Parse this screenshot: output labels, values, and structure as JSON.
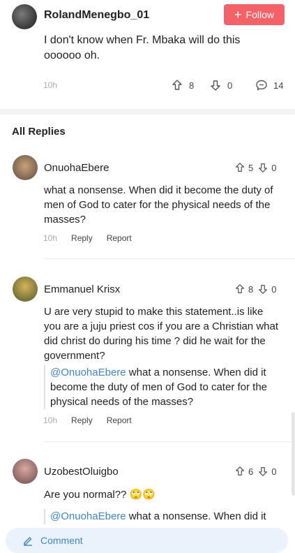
{
  "post": {
    "username": "RolandMenegbo_01",
    "follow_label": "Follow",
    "content": "I don't know when Fr. Mbaka will do this oooooo oh.",
    "time": "10h",
    "upvotes": "8",
    "downvotes": "0",
    "comments": "14"
  },
  "section_title": "All Replies",
  "replies": [
    {
      "name": "OnuohaEbere",
      "upvotes": "5",
      "downvotes": "0",
      "text": "what a nonsense. When did it become the duty of men of God to cater for the physical needs of the masses?",
      "time": "10h",
      "reply_label": "Reply",
      "report_label": "Report"
    },
    {
      "name": "Emmanuel Krisx",
      "upvotes": "8",
      "downvotes": "0",
      "text": "U are very stupid to make this statement..is like you are a juju priest cos if you are a Christian what did christ do during his time ? did he wait for the government?",
      "quote_mention": "@OnuohaEbere",
      "quote_text": " what a nonsense. When did it become the duty of men of God to cater for the physical needs of the masses?",
      "time": "10h",
      "reply_label": "Reply",
      "report_label": "Report"
    },
    {
      "name": "UzobestOluigbo",
      "upvotes": "6",
      "downvotes": "0",
      "text": "Are you normal?? 🙄🙄",
      "quote_mention": "@OnuohaEbere",
      "quote_text": " what a nonsense. When did it"
    }
  ],
  "comment_bar": {
    "label": "Comment"
  },
  "colors": {
    "accent": "#f26266",
    "link": "#3f86c7"
  }
}
